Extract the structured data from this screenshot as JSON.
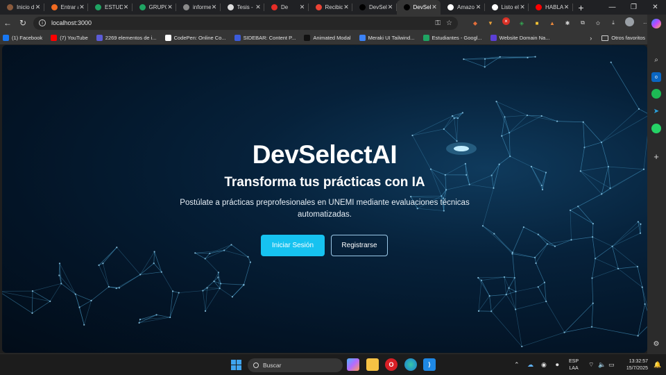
{
  "tabs": [
    {
      "title": "Inicio d",
      "favicon": "brown-circle-icon",
      "color": "#8a5a3c",
      "active": false
    },
    {
      "title": "Entrar a",
      "favicon": "x-logo-icon",
      "color": "#f26b21",
      "active": false
    },
    {
      "title": "ESTUDI",
      "favicon": "drive-icon",
      "color": "#1fa463",
      "active": false
    },
    {
      "title": "GRUPO",
      "favicon": "drive-icon",
      "color": "#1fa463",
      "active": false
    },
    {
      "title": "informe",
      "favicon": "document-icon",
      "color": "#8a8a8a",
      "active": false
    },
    {
      "title": "Tesis - ",
      "favicon": "chatgpt-icon",
      "color": "#dddddd",
      "active": false
    },
    {
      "title": "De",
      "favicon": "opera-icon",
      "color": "#e52d27",
      "active": false
    },
    {
      "title": "Recibid",
      "favicon": "gmail-icon",
      "color": "#ea4335",
      "active": false
    },
    {
      "title": "DevSel",
      "favicon": "nextjs-icon",
      "color": "#000000",
      "active": false
    },
    {
      "title": "DevSel",
      "favicon": "nextjs-icon",
      "color": "#000000",
      "active": true
    },
    {
      "title": "Amazo",
      "favicon": "amazon-icon",
      "color": "#ffffff",
      "active": false
    },
    {
      "title": "Listo el",
      "favicon": "github-icon",
      "color": "#ffffff",
      "active": false
    },
    {
      "title": "HABLA",
      "favicon": "youtube-icon",
      "color": "#ff0000",
      "active": false
    }
  ],
  "toolbar": {
    "url": "localhost:3000",
    "new_tab": "+",
    "minimize": "—",
    "restore": "❐",
    "close": "✕"
  },
  "bookmarks": [
    {
      "label": "(1) Facebook",
      "icon": "facebook-icon",
      "color": "#1877f2"
    },
    {
      "label": "(7) YouTube",
      "icon": "youtube-icon",
      "color": "#ff0000"
    },
    {
      "label": "2269 elementos de i...",
      "icon": "bookmark-icon",
      "color": "#5b5bd6"
    },
    {
      "label": "CodePen: Online Co...",
      "icon": "codepen-icon",
      "color": "#ffffff"
    },
    {
      "label": "SIDEBAR: Content P...",
      "icon": "sidebar-icon",
      "color": "#3b5bdb"
    },
    {
      "label": "Animated Modal",
      "icon": "aceternity-icon",
      "color": "#111111"
    },
    {
      "label": "Meraki UI Tailwind...",
      "icon": "meraki-icon",
      "color": "#3b82f6"
    },
    {
      "label": "Estudiantes - Googl...",
      "icon": "drive-icon",
      "color": "#1fa463"
    },
    {
      "label": "Website Domain Na...",
      "icon": "domain-icon",
      "color": "#5b3fd6"
    }
  ],
  "bookmarks_folder": "Otros favoritos",
  "hero": {
    "title": "DevSelectAI",
    "subtitle": "Transforma tus prácticas con IA",
    "description": "Postúlate a prácticas preprofesionales en UNEMI mediante evaluaciones técnicas automatizadas.",
    "login_label": "Iniciar Sesión",
    "register_label": "Registrarse"
  },
  "colors": {
    "accent": "#16c2f0",
    "background": "#031426"
  },
  "taskbar": {
    "search_placeholder": "Buscar",
    "language_1": "ESP",
    "language_2": "LAA",
    "time": "13:32:57",
    "date": "15/7/2025"
  }
}
